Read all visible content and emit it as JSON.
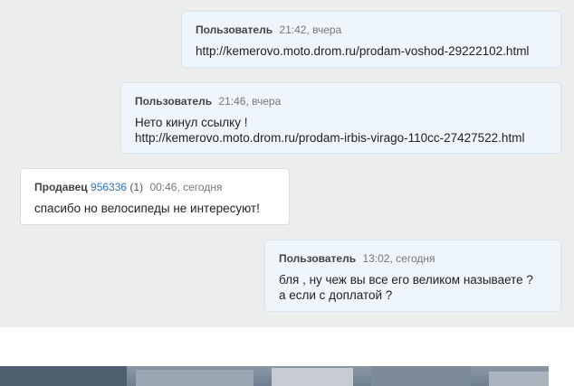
{
  "messages": [
    {
      "author": "Пользователь",
      "time": "21:42, вчера",
      "lines": [
        "http://kemerovo.moto.drom.ru/prodam-voshod-29222102.html"
      ]
    },
    {
      "author": "Пользователь",
      "time": "21:46, вчера",
      "lines": [
        "Нето кинул ссылку !",
        "http://kemerovo.moto.drom.ru/prodam-irbis-virago-110cc-27427522.html"
      ]
    },
    {
      "author": "Продавец",
      "seller_id": "956336",
      "rating": "(1)",
      "time": "00:46, сегодня",
      "lines": [
        "спасибо но велосипеды не интересуют!"
      ]
    },
    {
      "author": "Пользователь",
      "time": "13:02, сегодня",
      "lines": [
        "бля , ну чеж вы все его великом называете ?",
        "а если с доплатой ?"
      ]
    }
  ],
  "colors": {
    "chat_background": "#eceeee",
    "user_bubble": "#eef5fb",
    "seller_bubble": "#ffffff",
    "seller_id_link": "#2c73b8"
  }
}
